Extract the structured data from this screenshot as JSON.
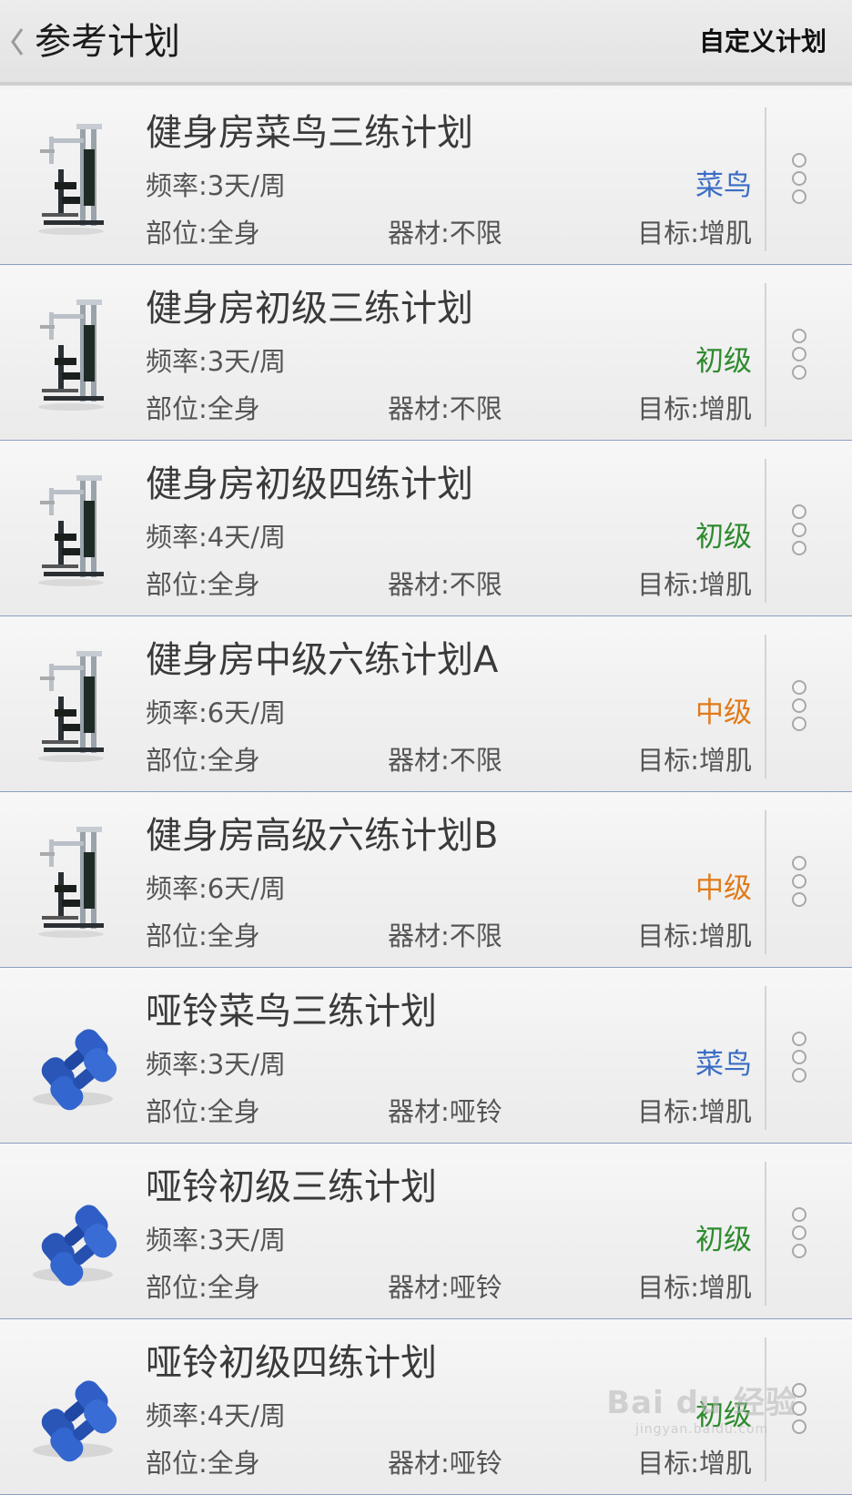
{
  "header": {
    "title": "参考计划",
    "action_label": "自定义计划",
    "back_icon": "chevron-left-icon"
  },
  "colors": {
    "level_beginner_rookie": "#3a6cc4",
    "level_beginner": "#2e8b2e",
    "level_intermediate": "#e07a1a"
  },
  "plans": [
    {
      "icon": "gym-machine-icon",
      "title": "健身房菜鸟三练计划",
      "frequency": "频率:3天/周",
      "level": "菜鸟",
      "level_color": "#3a6cc4",
      "body_part": "部位:全身",
      "equipment": "器材:不限",
      "goal": "目标:增肌"
    },
    {
      "icon": "gym-machine-icon",
      "title": "健身房初级三练计划",
      "frequency": "频率:3天/周",
      "level": "初级",
      "level_color": "#2e8b2e",
      "body_part": "部位:全身",
      "equipment": "器材:不限",
      "goal": "目标:增肌"
    },
    {
      "icon": "gym-machine-icon",
      "title": "健身房初级四练计划",
      "frequency": "频率:4天/周",
      "level": "初级",
      "level_color": "#2e8b2e",
      "body_part": "部位:全身",
      "equipment": "器材:不限",
      "goal": "目标:增肌"
    },
    {
      "icon": "gym-machine-icon",
      "title": "健身房中级六练计划A",
      "frequency": "频率:6天/周",
      "level": "中级",
      "level_color": "#e07a1a",
      "body_part": "部位:全身",
      "equipment": "器材:不限",
      "goal": "目标:增肌"
    },
    {
      "icon": "gym-machine-icon",
      "title": "健身房高级六练计划B",
      "frequency": "频率:6天/周",
      "level": "中级",
      "level_color": "#e07a1a",
      "body_part": "部位:全身",
      "equipment": "器材:不限",
      "goal": "目标:增肌"
    },
    {
      "icon": "dumbbell-icon",
      "title": "哑铃菜鸟三练计划",
      "frequency": "频率:3天/周",
      "level": "菜鸟",
      "level_color": "#3a6cc4",
      "body_part": "部位:全身",
      "equipment": "器材:哑铃",
      "goal": "目标:增肌"
    },
    {
      "icon": "dumbbell-icon",
      "title": "哑铃初级三练计划",
      "frequency": "频率:3天/周",
      "level": "初级",
      "level_color": "#2e8b2e",
      "body_part": "部位:全身",
      "equipment": "器材:哑铃",
      "goal": "目标:增肌"
    },
    {
      "icon": "dumbbell-icon",
      "title": "哑铃初级四练计划",
      "frequency": "频率:4天/周",
      "level": "初级",
      "level_color": "#2e8b2e",
      "body_part": "部位:全身",
      "equipment": "器材:哑铃",
      "goal": "目标:增肌"
    }
  ],
  "watermark": {
    "text": "Bai du 经验",
    "subtext": "jingyan.baidu.com"
  }
}
